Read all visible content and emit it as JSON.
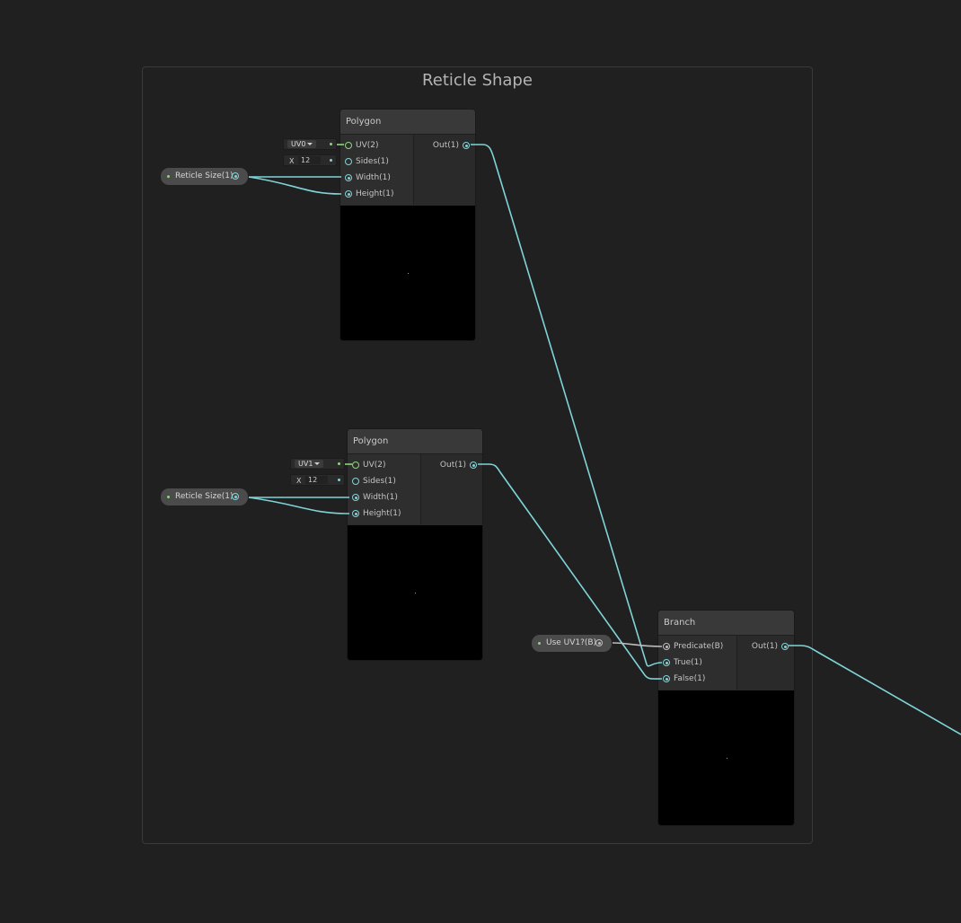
{
  "group": {
    "title": "Reticle Shape"
  },
  "colors": {
    "background": "#202020",
    "wire": "#7fd4d8",
    "boolean_wire": "#bdbdbd",
    "uv_port": "#8ed47f"
  },
  "polygon_top": {
    "title": "Polygon",
    "inputs": [
      "UV(2)",
      "Sides(1)",
      "Width(1)",
      "Height(1)"
    ],
    "output": "Out(1)",
    "uv_value": "UV0",
    "sides_axis": "X",
    "sides_value": "12"
  },
  "polygon_bottom": {
    "title": "Polygon",
    "inputs": [
      "UV(2)",
      "Sides(1)",
      "Width(1)",
      "Height(1)"
    ],
    "output": "Out(1)",
    "uv_value": "UV1",
    "sides_axis": "X",
    "sides_value": "12"
  },
  "branch": {
    "title": "Branch",
    "inputs": [
      "Predicate(B)",
      "True(1)",
      "False(1)"
    ],
    "output": "Out(1)"
  },
  "properties": {
    "reticle_size_top": "Reticle Size(1)",
    "reticle_size_bottom": "Reticle Size(1)",
    "use_uv1": "Use UV1?(B)"
  }
}
